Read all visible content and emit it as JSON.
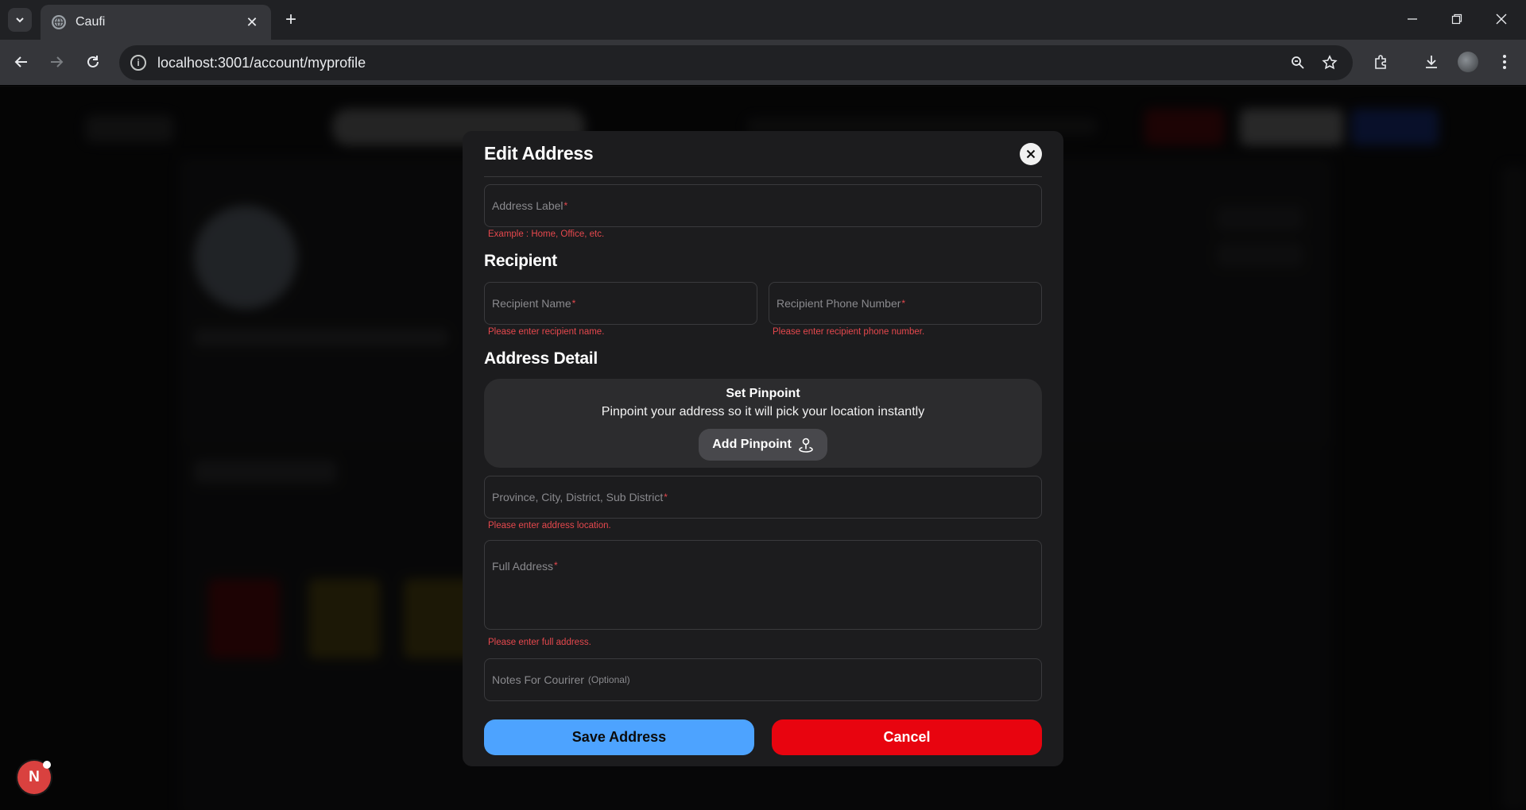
{
  "browser": {
    "tab_title": "Caufi",
    "url": "localhost:3001/account/myprofile"
  },
  "modal": {
    "title": "Edit Address",
    "address_label": {
      "placeholder": "Address Label",
      "required_mark": "*",
      "hint": "Example : Home, Office, etc."
    },
    "recipient_section": "Recipient",
    "recipient_name": {
      "placeholder": "Recipient Name",
      "required_mark": "*",
      "error": "Please enter recipient name."
    },
    "recipient_phone": {
      "placeholder": "Recipient Phone Number",
      "required_mark": "*",
      "error": "Please enter recipient phone number."
    },
    "address_detail_section": "Address Detail",
    "pinpoint": {
      "title": "Set Pinpoint",
      "description": "Pinpoint your address so it will pick your location instantly",
      "button_label": "Add Pinpoint"
    },
    "location": {
      "placeholder": "Province, City, District, Sub District",
      "required_mark": "*",
      "error": "Please enter address location."
    },
    "full_address": {
      "placeholder": "Full Address",
      "required_mark": "*",
      "error": "Please enter full address."
    },
    "notes": {
      "placeholder": "Notes For Courirer",
      "optional": "(Optional)"
    },
    "save_label": "Save Address",
    "cancel_label": "Cancel"
  },
  "dev_badge": "N",
  "colors": {
    "accent_blue": "#4da3ff",
    "danger_red": "#e8040f",
    "error_text": "#e5484d",
    "modal_bg": "#1c1c1e"
  }
}
